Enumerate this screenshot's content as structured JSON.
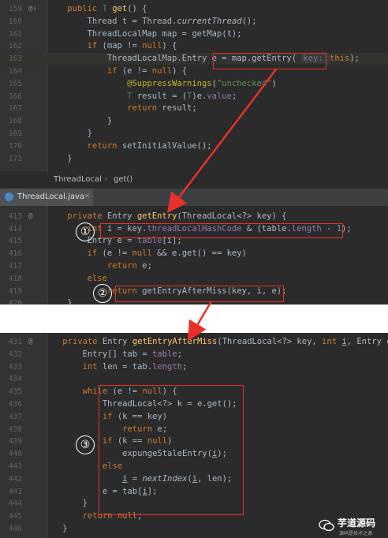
{
  "breadcrumb": {
    "class": "ThreadLocal",
    "method": "get()"
  },
  "tab": {
    "label": "ThreadLocal.java",
    "close": "×"
  },
  "panel1": [
    {
      "n": "159",
      "tokens": [
        [
          "    ",
          ""
        ],
        [
          "public ",
          "tk-kw"
        ],
        [
          "T ",
          "tk-gen"
        ],
        [
          "get",
          "tk-fn"
        ],
        [
          "() {",
          ""
        ]
      ]
    },
    {
      "n": "160",
      "tokens": [
        [
          "        Thread t = Thread.",
          ""
        ],
        [
          "currentThread",
          "tk-it"
        ],
        [
          "();",
          ""
        ]
      ]
    },
    {
      "n": "161",
      "tokens": [
        [
          "        ThreadLocalMap map = getMap(t);",
          ""
        ]
      ]
    },
    {
      "n": "162",
      "tokens": [
        [
          "        ",
          ""
        ],
        [
          "if ",
          "tk-kw"
        ],
        [
          "(map != ",
          ""
        ],
        [
          "null",
          "tk-kw"
        ],
        [
          ") {",
          ""
        ]
      ]
    },
    {
      "n": "163",
      "hl": true,
      "tokens": [
        [
          "            ThreadLocalMap.Entry e = map.getEntry( ",
          ""
        ],
        [
          "key: ",
          "hint"
        ],
        [
          "this",
          "tk-kw"
        ],
        [
          ");",
          ""
        ]
      ]
    },
    {
      "n": "164",
      "tokens": [
        [
          "            ",
          ""
        ],
        [
          "if ",
          "tk-kw"
        ],
        [
          "(e != ",
          ""
        ],
        [
          "null",
          "tk-kw"
        ],
        [
          ") {",
          ""
        ]
      ]
    },
    {
      "n": "165",
      "tokens": [
        [
          "                ",
          ""
        ],
        [
          "@SuppressWarnings",
          "tk-ann"
        ],
        [
          "(",
          ""
        ],
        [
          "\"unchecked\"",
          "tk-str"
        ],
        [
          ")",
          ""
        ]
      ]
    },
    {
      "n": "166",
      "tokens": [
        [
          "                ",
          ""
        ],
        [
          "T ",
          "tk-gen"
        ],
        [
          "result = (",
          ""
        ],
        [
          "T",
          "tk-gen"
        ],
        [
          ")e.",
          ""
        ],
        [
          "value",
          "tk-field"
        ],
        [
          ";",
          ""
        ]
      ]
    },
    {
      "n": "167",
      "tokens": [
        [
          "                ",
          ""
        ],
        [
          "return ",
          "tk-kw"
        ],
        [
          "result;",
          ""
        ]
      ]
    },
    {
      "n": "168",
      "tokens": [
        [
          "            }",
          ""
        ]
      ]
    },
    {
      "n": "169",
      "tokens": [
        [
          "        }",
          ""
        ]
      ]
    },
    {
      "n": "170",
      "tokens": [
        [
          "        ",
          ""
        ],
        [
          "return ",
          "tk-kw"
        ],
        [
          "setInitialValue();",
          ""
        ]
      ]
    },
    {
      "n": "171",
      "tokens": [
        [
          "    }",
          ""
        ]
      ]
    }
  ],
  "panel2": [
    {
      "n": "",
      "tokens": [
        [
          "",
          ""
        ]
      ]
    },
    {
      "n": "413",
      "tokens": [
        [
          "    ",
          ""
        ],
        [
          "private ",
          "tk-kw"
        ],
        [
          "Entry ",
          ""
        ],
        [
          "getEntry",
          "tk-fn"
        ],
        [
          "(ThreadLocal<?> key) {",
          ""
        ]
      ]
    },
    {
      "n": "414",
      "tokens": [
        [
          "        ",
          ""
        ],
        [
          "int ",
          "tk-kw"
        ],
        [
          "i = key.",
          ""
        ],
        [
          "threadLocalHashCode",
          "tk-field"
        ],
        [
          " & (table.",
          ""
        ],
        [
          "length",
          "tk-field"
        ],
        [
          " - ",
          ""
        ],
        [
          "1",
          "tk-num"
        ],
        [
          ");",
          ""
        ]
      ]
    },
    {
      "n": "415",
      "tokens": [
        [
          "        Entry e = ",
          ""
        ],
        [
          "table",
          "tk-field"
        ],
        [
          "[i];",
          ""
        ]
      ]
    },
    {
      "n": "416",
      "tokens": [
        [
          "        ",
          ""
        ],
        [
          "if ",
          "tk-kw"
        ],
        [
          "(e != ",
          ""
        ],
        [
          "null ",
          "tk-kw"
        ],
        [
          "&& e.get() == key)",
          ""
        ]
      ]
    },
    {
      "n": "417",
      "tokens": [
        [
          "            ",
          ""
        ],
        [
          "return ",
          "tk-kw"
        ],
        [
          "e;",
          ""
        ]
      ]
    },
    {
      "n": "418",
      "tokens": [
        [
          "        ",
          ""
        ],
        [
          "else",
          "tk-kw"
        ]
      ]
    },
    {
      "n": "419",
      "tokens": [
        [
          "            ",
          ""
        ],
        [
          "return ",
          "tk-kw"
        ],
        [
          "getEntryAfterMiss(key, i, e);",
          ""
        ]
      ]
    },
    {
      "n": "420",
      "tokens": [
        [
          "    }",
          ""
        ]
      ]
    }
  ],
  "panel3": [
    {
      "n": "431",
      "tokens": [
        [
          "    ",
          ""
        ],
        [
          "private ",
          "tk-kw"
        ],
        [
          "Entry ",
          ""
        ],
        [
          "getEntryAfterMiss",
          "tk-fn"
        ],
        [
          "(ThreadLocal<?> key, ",
          ""
        ],
        [
          "int ",
          "tk-kw"
        ],
        [
          "i",
          "tk-ul"
        ],
        [
          ", Entry e) {",
          ""
        ]
      ]
    },
    {
      "n": "432",
      "tokens": [
        [
          "        Entry[] tab = ",
          ""
        ],
        [
          "table",
          "tk-field"
        ],
        [
          ";",
          ""
        ]
      ]
    },
    {
      "n": "433",
      "tokens": [
        [
          "        ",
          ""
        ],
        [
          "int ",
          "tk-kw"
        ],
        [
          "len = tab.",
          ""
        ],
        [
          "length",
          "tk-field"
        ],
        [
          ";",
          ""
        ]
      ]
    },
    {
      "n": "434",
      "tokens": [
        [
          "",
          ""
        ]
      ]
    },
    {
      "n": "435",
      "tokens": [
        [
          "        ",
          ""
        ],
        [
          "while ",
          "tk-kw"
        ],
        [
          "(e != ",
          ""
        ],
        [
          "null",
          "tk-kw"
        ],
        [
          ") {",
          ""
        ]
      ]
    },
    {
      "n": "436",
      "tokens": [
        [
          "            ThreadLocal<?> k = e.get();",
          ""
        ]
      ]
    },
    {
      "n": "437",
      "tokens": [
        [
          "            ",
          ""
        ],
        [
          "if ",
          "tk-kw"
        ],
        [
          "(k == key)",
          ""
        ]
      ]
    },
    {
      "n": "438",
      "tokens": [
        [
          "                ",
          ""
        ],
        [
          "return ",
          "tk-kw"
        ],
        [
          "e;",
          ""
        ]
      ]
    },
    {
      "n": "439",
      "tokens": [
        [
          "            ",
          ""
        ],
        [
          "if ",
          "tk-kw"
        ],
        [
          "(k == ",
          ""
        ],
        [
          "null",
          "tk-kw"
        ],
        [
          ")",
          ""
        ]
      ]
    },
    {
      "n": "440",
      "tokens": [
        [
          "                expungeStaleEntry(",
          ""
        ],
        [
          "i",
          "tk-ul"
        ],
        [
          ");",
          ""
        ]
      ]
    },
    {
      "n": "441",
      "tokens": [
        [
          "            ",
          ""
        ],
        [
          "else",
          "tk-kw"
        ]
      ]
    },
    {
      "n": "442",
      "tokens": [
        [
          "                ",
          ""
        ],
        [
          "i",
          "tk-ul"
        ],
        [
          " = ",
          ""
        ],
        [
          "nextIndex",
          "tk-it"
        ],
        [
          "(",
          ""
        ],
        [
          "i",
          "tk-ul"
        ],
        [
          ", len);",
          ""
        ]
      ]
    },
    {
      "n": "443",
      "tokens": [
        [
          "            e = tab[",
          ""
        ],
        [
          "i",
          "tk-ul"
        ],
        [
          "];",
          ""
        ]
      ]
    },
    {
      "n": "444",
      "tokens": [
        [
          "        }",
          ""
        ]
      ]
    },
    {
      "n": "445",
      "tokens": [
        [
          "        ",
          ""
        ],
        [
          "return ",
          "tk-kw"
        ],
        [
          "null",
          "tk-kw"
        ],
        [
          ";",
          ""
        ]
      ]
    },
    {
      "n": "446",
      "tokens": [
        [
          "    }",
          ""
        ]
      ]
    }
  ],
  "callouts": {
    "one": "①",
    "two": "②",
    "three": "③"
  },
  "colors": {
    "highlight_box": "#e8302b",
    "arrow": "#e8302b"
  },
  "watermark": {
    "text": "芋道源码",
    "subtext": "源码是技术之源"
  }
}
